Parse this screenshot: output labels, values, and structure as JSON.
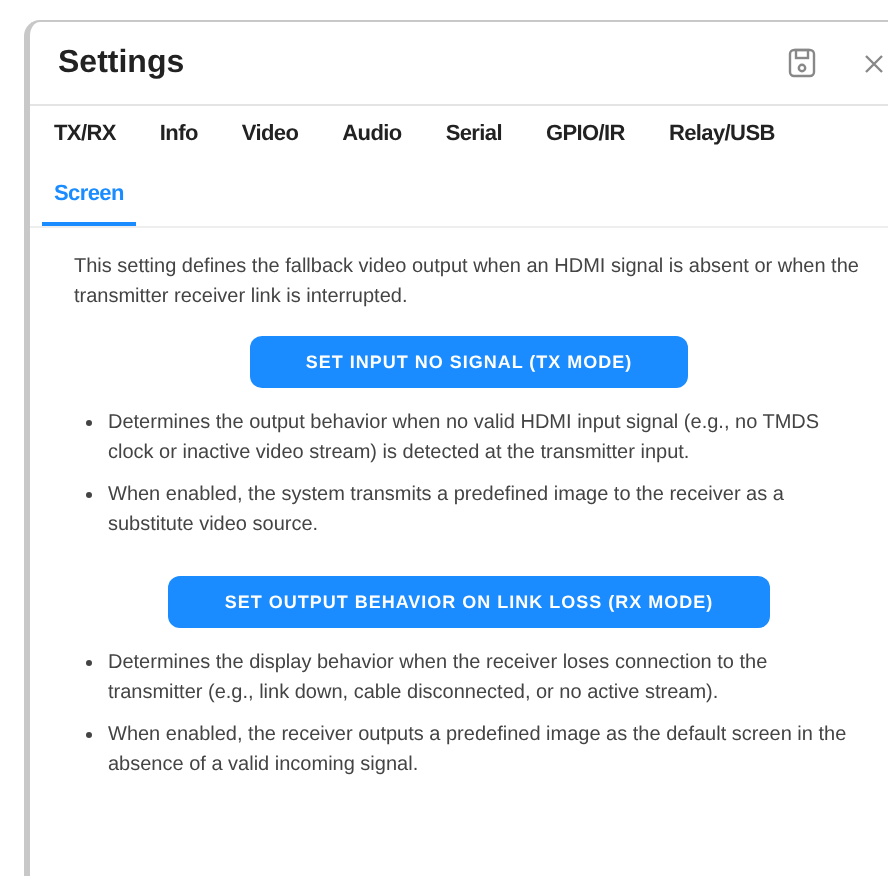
{
  "window": {
    "title": "Settings"
  },
  "tabs": [
    {
      "label": "TX/RX",
      "selected": false
    },
    {
      "label": "Info",
      "selected": false
    },
    {
      "label": "Video",
      "selected": false
    },
    {
      "label": "Audio",
      "selected": false
    },
    {
      "label": "Serial",
      "selected": false
    },
    {
      "label": "GPIO/IR",
      "selected": false
    },
    {
      "label": "Relay/USB",
      "selected": false
    },
    {
      "label": "Screen",
      "selected": true
    }
  ],
  "intro": "This setting defines the fallback video output when an HDMI signal is absent or when the transmitter receiver link is interrupted.",
  "sections": [
    {
      "button": "SET INPUT NO SIGNAL (TX MODE)",
      "bullets": [
        "Determines the output behavior when no valid HDMI input signal (e.g., no TMDS clock or inactive video stream) is detected at the transmitter input.",
        "When enabled, the system transmits a predefined image to the receiver as a substitute video source."
      ]
    },
    {
      "button": "SET OUTPUT BEHAVIOR ON LINK LOSS (RX MODE)",
      "bullets": [
        "Determines the display behavior when the receiver loses connection to the transmitter (e.g., link down, cable disconnected, or no active stream).",
        "When enabled, the receiver outputs a predefined image as the default screen in the absence of a valid incoming signal."
      ]
    }
  ]
}
